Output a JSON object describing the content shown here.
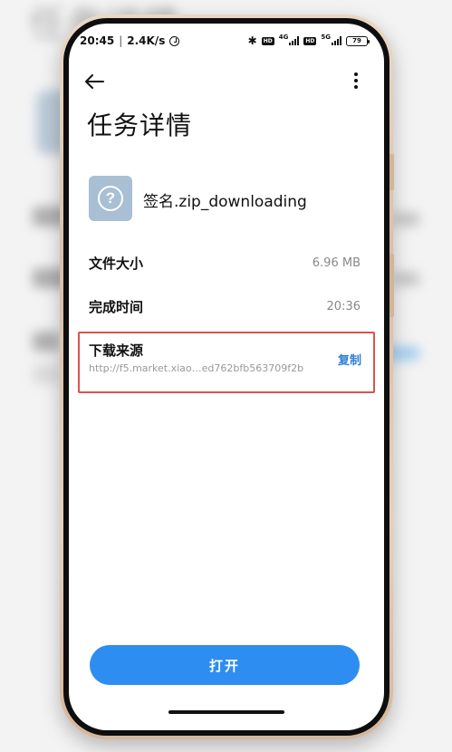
{
  "background": {
    "blurred_title": "任务详情"
  },
  "status_bar": {
    "time": "20:45",
    "net_speed": "2.4K/s",
    "separator": "|",
    "sim1_network": "4G",
    "sim2_network": "5G",
    "battery": "79",
    "hd_badge": "HD",
    "bluetooth_glyph": "✱"
  },
  "header": {
    "back_icon": "arrow-left-icon",
    "more_icon": "more-vertical-icon",
    "title": "任务详情"
  },
  "file": {
    "icon": "question-icon",
    "icon_glyph": "?",
    "name": "签名.zip_downloading"
  },
  "details": {
    "size_label": "文件大小",
    "size_value": "6.96 MB",
    "time_label": "完成时间",
    "time_value": "20:36",
    "source_label": "下载来源",
    "source_url": "http://f5.market.xiao…ed762bfb563709f2b",
    "copy_label": "复制"
  },
  "actions": {
    "open_label": "打开"
  },
  "colors": {
    "accent": "#2e8df0",
    "link": "#2f7fd6",
    "highlight_border": "#d9534f",
    "file_icon_bg": "#a9bfd4"
  }
}
